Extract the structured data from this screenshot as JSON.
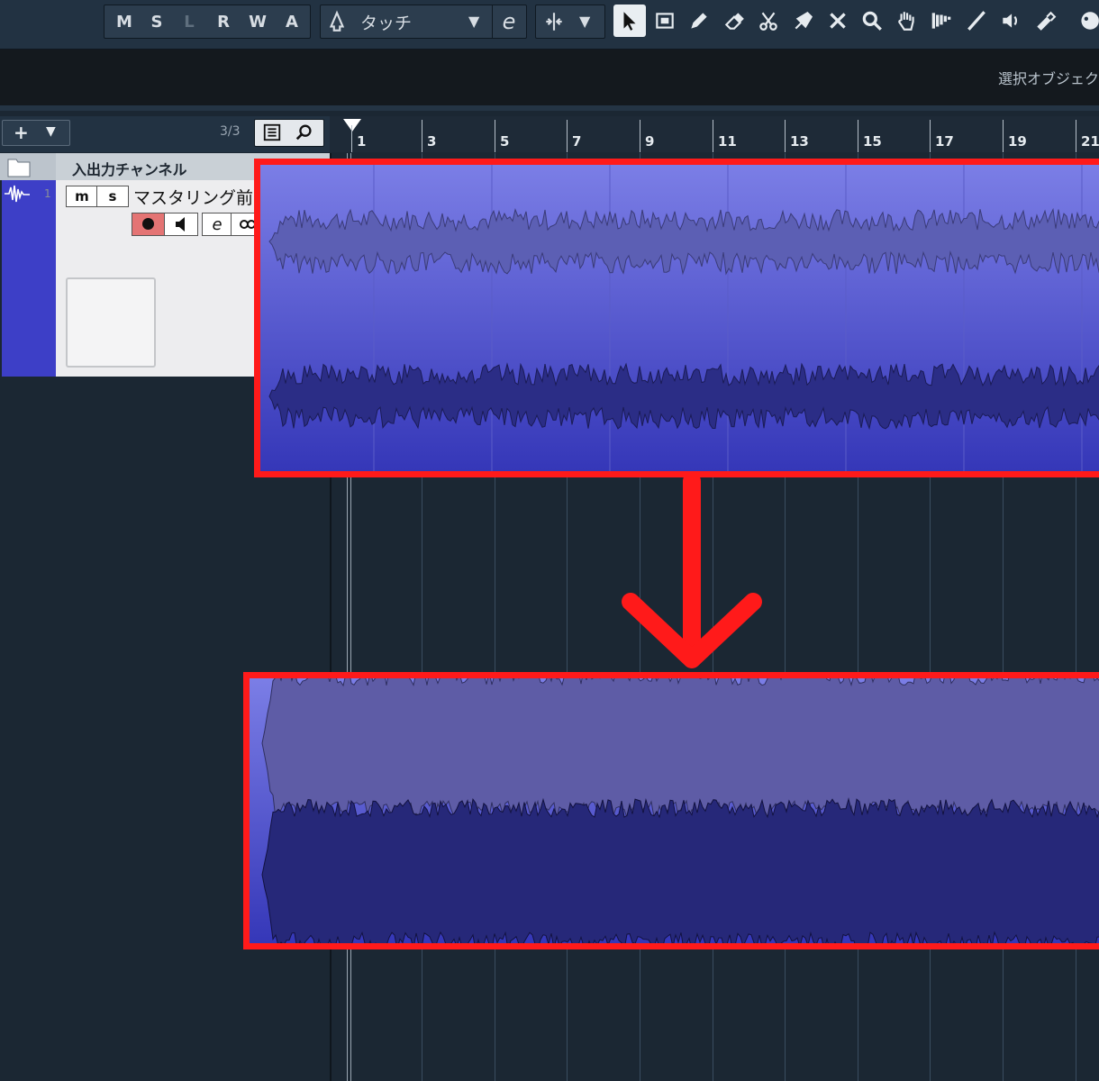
{
  "toolbar": {
    "mode_buttons": [
      "M",
      "S",
      "L",
      "R",
      "W",
      "A"
    ],
    "automation_mode": "タッチ",
    "e_label": "e"
  },
  "infobar": {
    "selection_label": "選択オブジェク"
  },
  "tracklist": {
    "add_label": "+",
    "count": "3/3",
    "folder_name": "入出力チャンネル",
    "track": {
      "number": "1",
      "mute_label": "m",
      "solo_label": "s",
      "name": "マスタリング前",
      "e_label": "e"
    }
  },
  "ruler": {
    "bars": [
      "1",
      "3",
      "5",
      "7",
      "9",
      "11",
      "13",
      "15",
      "17",
      "19",
      "21"
    ]
  },
  "colors": {
    "highlight": "#ff1a1a",
    "clip_top": "#7b7ee6",
    "clip_bottom": "#3537b8",
    "track_color": "#3d3fc7"
  }
}
